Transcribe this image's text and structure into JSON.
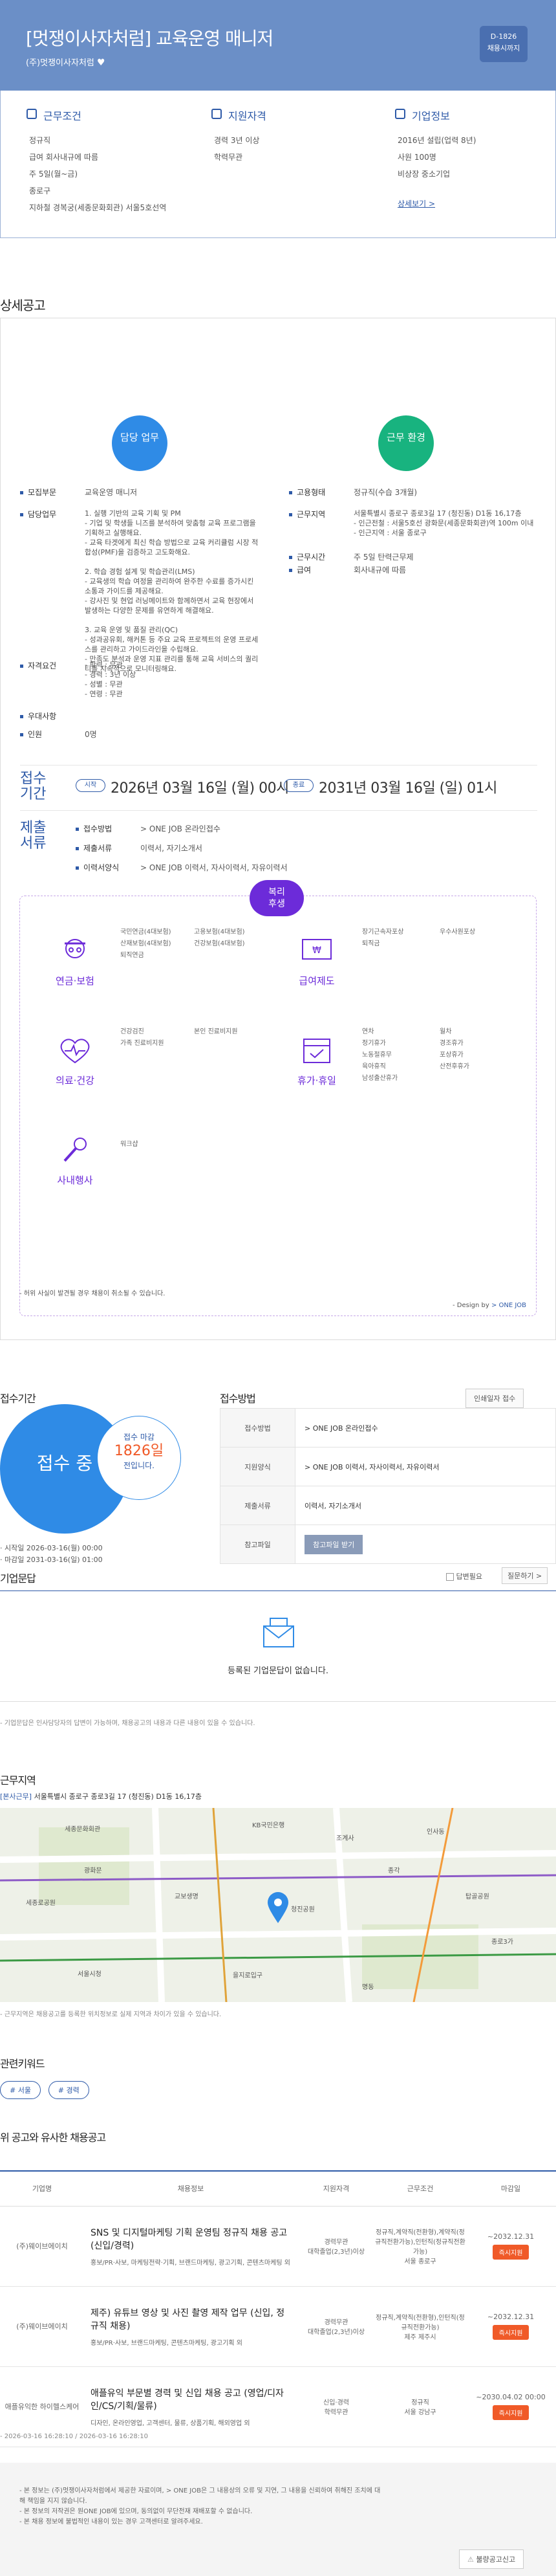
{
  "header": {
    "title": "[멋쟁이사자처럼] 교육운영 매니저",
    "company": "(주)멋쟁이사자처럼",
    "dday_label": "D-1826",
    "dday_sub": "채용시까지"
  },
  "summary": {
    "conditions": {
      "title": "근무조건",
      "items": [
        "정규직",
        "급여 회사내규에 따름",
        "주 5일(월~금)",
        "종로구",
        "지하철 경복궁(세종문화회관) 서울5호선역"
      ]
    },
    "qualifications": {
      "title": "지원자격",
      "items": [
        "경력 3년 이상",
        "학력무관"
      ]
    },
    "company": {
      "title": "기업정보",
      "items": [
        "2016년 설립(업력 8년)",
        "사원 100명",
        "비상장 중소기업"
      ],
      "link": "상세보기 >"
    }
  },
  "detail": {
    "section_title": "상세공고",
    "duty_badge": "담당 업무",
    "env_badge": "근무 환경",
    "rows_left": [
      {
        "k": "모집부문",
        "v": "교육운영 매니저"
      },
      {
        "k": "담당업무",
        "v": "1. 실행 기반의 교육 기획 및 PM\n- 기업 및 학생들 니즈를 분석하여 맞춤형 교육 프로그램을 기획하고 실행해요.\n- 교육 타겟에게 최신 학습 방법으로 교육 커리큘럼 시장 적합성(PMF)을 검증하고 고도화해요.\n\n2. 학습 경험 설계 및 학습관리(LMS)\n- 교육생의 학습 여정을 관리하여 완주한 수료를 증가시킨 소통과 가이드를 제공해요.\n- 강사진 및 현업 러닝메이트와 함께하면서 교육 현장에서 발생하는 다양한 문제를 유연하게 해결해요.\n\n3. 교육 운영 및 품질 관리(QC)\n- 성과공유회, 해커톤 등 주요 교육 프로젝트의 운영 프로세스를 관리하고 가이드라인을 수립해요.\n- 만족도 분석과 운영 지표 관리를 통해 교육 서비스의 퀄리티를 지속적으로 모니터링해요."
      },
      {
        "k": "자격요건",
        "v": "- 학력 : 무관\n- 경력 : 3년 이상\n- 성별 : 무관\n- 연령 : 무관"
      },
      {
        "k": "우대사항",
        "v": ""
      },
      {
        "k": "인원",
        "v": "0명"
      }
    ],
    "rows_right": [
      {
        "k": "고용형태",
        "v": "정규직(수습 3개월)"
      },
      {
        "k": "근무지역",
        "v": "서울특별시 종로구 종로3길 17 (청진동) D1동 16,17층\n- 인근전철 : 서울5호선 광화문(세종문화회관)역 100m 이내\n- 인근지역 : 서울 종로구"
      },
      {
        "k": "근무시간",
        "v": "주 5일 탄력근무제"
      },
      {
        "k": "급여",
        "v": "회사내규에 따름"
      }
    ],
    "period_label": "접수\n기간",
    "start_pill": "시작",
    "start_date": "2026년 03월 16일 (월) 00시",
    "end_pill": "종료",
    "end_date": "2031년 03월 16일 (일) 01시",
    "docs_label": "제출\n서류",
    "docs": [
      {
        "k": "접수방법",
        "v": "> ONE JOB 온라인접수"
      },
      {
        "k": "제출서류",
        "v": "이력서, 자기소개서"
      },
      {
        "k": "이력서양식",
        "v": "> ONE JOB 이력서, 자사이력서, 자유이력서"
      }
    ],
    "welfare_badge": "복리\n후생",
    "welfare": [
      {
        "label": "연금·보험",
        "items": [
          "국민연금(4대보험)",
          "고용보험(4대보험)",
          "산재보험(4대보험)",
          "건강보험(4대보험)",
          "퇴직연금"
        ]
      },
      {
        "label": "급여제도",
        "items": [
          "장기근속자포상",
          "우수사원포상",
          "퇴직금"
        ]
      },
      {
        "label": "의료·건강",
        "items": [
          "건강검진",
          "본인 진료비지원",
          "가족 진료비지원"
        ]
      },
      {
        "label": "휴가·휴일",
        "items": [
          "연차",
          "월차",
          "정기휴가",
          "경조휴가",
          "노동절휴무",
          "포상휴가",
          "육아휴직",
          "산전후휴가",
          "남성출산휴가"
        ]
      },
      {
        "label": "사내행사",
        "items": [
          "워크샵"
        ]
      }
    ],
    "footnote": "- 허위 사실이 발견될 경우 채용이 취소될 수 있습니다.",
    "design_by": "- Design by ",
    "design_brand": "> ONE JOB"
  },
  "receipt": {
    "period_title": "접수기간",
    "status": "접수 중",
    "deadline_label": "접수 마감",
    "deadline_days": "1826일",
    "deadline_suffix": "전입니다.",
    "start": "· 시작일 2026-03-16(월) 00:00",
    "end": "· 마감일 2031-03-16(일) 01:00",
    "method_title": "접수방법",
    "print_btn": "인쇄일자 접수",
    "table": [
      {
        "h": "접수방법",
        "v": "> ONE JOB 온라인접수"
      },
      {
        "h": "지원양식",
        "v": "> ONE JOB 이력서, 자사이력서, 자유이력서"
      },
      {
        "h": "제출서류",
        "v": "이력서, 자기소개서"
      },
      {
        "h": "참고파일",
        "v": "참고파일 받기"
      }
    ]
  },
  "qa": {
    "title": "기업문답",
    "check_label": "답변필요",
    "sort": "질문하기 >",
    "empty": "등록된 기업문답이 없습니다.",
    "note": "- 기업문답은 인사담당자의 답변이 가능하며, 채용공고의 내용과 다른 내용이 있을 수 있습니다."
  },
  "location": {
    "title": "근무지역",
    "address_label": "[본사근무]",
    "address": "서울특별시 종로구 종로3길 17 (청진동) D1동 16,17층",
    "map_labels": [
      "세종문화회관",
      "KB국민은행",
      "광화문",
      "종각",
      "교보생명",
      "청진공원",
      "세종로공원",
      "서울시청",
      "조계사",
      "인사동",
      "탑골공원",
      "종로3가",
      "을지로입구",
      "명동"
    ],
    "note": "- 근무지역은 채용공고를 등록한 위치정보로 실제 지역과 차이가 있을 수 있습니다."
  },
  "keywords": {
    "title": "관련키워드",
    "items": [
      "# 서울",
      "# 경력"
    ]
  },
  "similar": {
    "title": "위 공고와 유사한 채용공고",
    "headers": [
      "기업명",
      "채용정보",
      "지원자격",
      "근무조건",
      "마감일"
    ],
    "rows": [
      {
        "company": "(주)웨이브에이치",
        "title": "SNS 및 디지털마케팅 기획 운영팀 정규직 채용 공고 (신입/경력)",
        "desc": "홍보/PR·사보, 마케팅전략·기획, 브랜드마케팅, 광고기획, 콘텐츠마케팅 외",
        "qual": "경력무관\n대학졸업(2,3년)이상",
        "cond": "정규직,계약직(전환형),계약직(정규직전환가능),인턴직(정규직전환가능)\n서울 종로구",
        "deadline": "~2032.12.31",
        "apply": "즉시지원"
      },
      {
        "company": "(주)웨이브에이치",
        "title": "제주) 유튜브 영상 및 사진 촬영 제작 업무 (신입, 정규직 채용)",
        "desc": "홍보/PR·사보, 브랜드마케팅, 콘텐츠마케팅, 광고기획 외",
        "qual": "경력무관\n대학졸업(2,3년)이상",
        "cond": "정규직,계약직(전환형),인턴직(정규직전환가능)\n제주 제주시",
        "deadline": "~2032.12.31",
        "apply": "즉시지원"
      },
      {
        "company": "애플유익한 하이헬스케어",
        "title": "애플유익 부문별 경력 및 신입 채용 공고 (영업/디자인/CS/기획/물류)",
        "desc": "디자인, 온라인영업, 고객센터, 물류, 상품기획, 해외영업 외",
        "qual": "신입·경력\n학력무관",
        "cond": "정규직\n서울 강남구",
        "deadline": "~2030.04.02 00:00",
        "apply": "즉시지원"
      }
    ]
  },
  "regdate": "- 2026-03-16 16:28:10 / 2026-03-16 16:28:10",
  "footer": {
    "lines": [
      "- 본 정보는 (주)멋쟁이사자처럼에서 제공한 자료이며, > ONE JOB은 그 내용상의 오류 및 지연, 그 내용을 신뢰하여 취해진 조치에 대해 책임을 지지 않습니다.",
      "- 본 정보의 저작권은 원ONE JOB에 있으며, 동의없이 무단전재 재배포할 수 없습니다.",
      "- 본 채용 정보에 불법적인 내용이 있는 경우 고객센터로 알려주세요."
    ],
    "report_btn": "불량공고신고"
  }
}
